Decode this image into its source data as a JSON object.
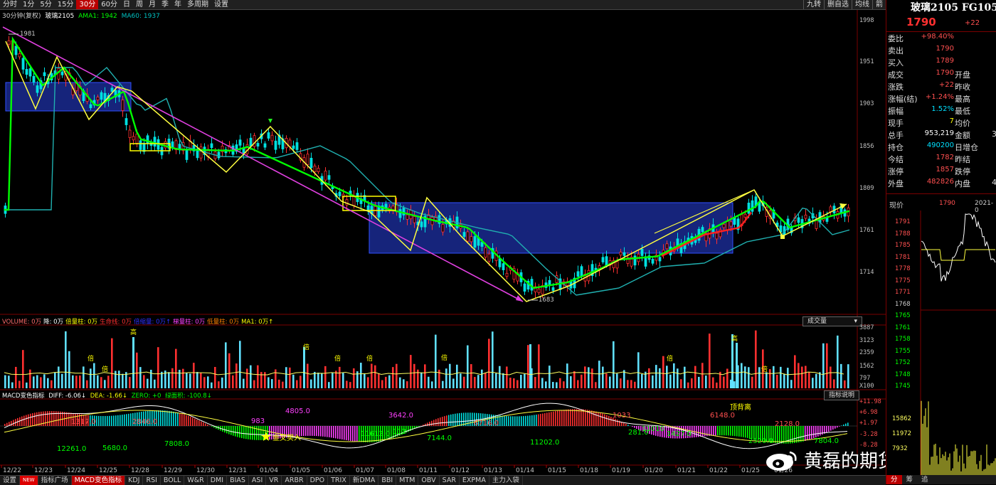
{
  "toolbar": {
    "period_tabs": [
      "分时",
      "1分",
      "5分",
      "15分",
      "30分",
      "60分",
      "日",
      "周",
      "月",
      "季",
      "年",
      "多周期",
      "设置"
    ],
    "active_tab": "30分",
    "right_buttons": [
      "九转",
      "删自选",
      "均线",
      "箭"
    ]
  },
  "main_info": {
    "period": "30分钟(复权)",
    "symbol": "玻璃2105",
    "ama": "AMA1: 1942",
    "ma60": "MA60: 1937"
  },
  "price_axis": [
    "1998",
    "1951",
    "1903",
    "1856",
    "1809",
    "1761",
    "1714"
  ],
  "price_labels": {
    "high": "1981",
    "low": "1683"
  },
  "volume_info": {
    "items": [
      {
        "text": "VOLUME: 0万",
        "color": "#ff6a6a"
      },
      {
        "text": "降: 0万",
        "color": "#ffffff"
      },
      {
        "text": "倍量柱: 0万",
        "color": "#ffff00"
      },
      {
        "text": "生命线: 0万",
        "color": "#ff3030"
      },
      {
        "text": "倍缩量: 0万↑",
        "color": "#3030ff"
      },
      {
        "text": "梯量柱: 0万",
        "color": "#ff40ff"
      },
      {
        "text": "低量柱: 0万",
        "color": "#ff8000"
      },
      {
        "text": "MA1: 0万↑",
        "color": "#ffff00"
      }
    ],
    "button": "成交量",
    "axis": [
      "3887",
      "3123",
      "2359",
      "1562",
      "797",
      "X100"
    ],
    "mark_bei": "倍",
    "mark_gao": "高"
  },
  "macd_info": {
    "name": "MACD变色指标",
    "diff": "DIFF: -6.06↓",
    "dea": "DEA: -1.66↓",
    "zero": "ZERO: +0",
    "area": "绿面积: -100.8↓",
    "button": "指标说明",
    "axis": [
      "+11.98",
      "+6.98",
      "+1.97",
      "-3.28",
      "-8.28"
    ],
    "values": [
      {
        "t": "1317.0",
        "c": "#ff5050"
      },
      {
        "t": "2846.0",
        "c": "#ff5050"
      },
      {
        "t": "12261.0",
        "c": "#00ff00"
      },
      {
        "t": "5680.0",
        "c": "#00ff00"
      },
      {
        "t": "7808.0",
        "c": "#00ff00"
      },
      {
        "t": "983",
        "c": "#ff40ff"
      },
      {
        "t": "4805.0",
        "c": "#ff40ff"
      },
      {
        "t": "3642.0",
        "c": "#ff40ff"
      },
      {
        "t": "11612.0",
        "c": "#00ff00"
      },
      {
        "t": "112",
        "c": "#00ff00"
      },
      {
        "t": "7144.0",
        "c": "#00ff00"
      },
      {
        "t": "6716.0",
        "c": "#ff5050"
      },
      {
        "t": "11202.0",
        "c": "#00ff00"
      },
      {
        "t": "1033",
        "c": "#ff5050"
      },
      {
        "t": "281.0",
        "c": "#00ff00"
      },
      {
        "t": "11010",
        "c": "#00ff00"
      },
      {
        "t": "1427.0",
        "c": "#00ff00"
      },
      {
        "t": "6148.0",
        "c": "#ff5050"
      },
      {
        "t": "2520.0",
        "c": "#00ff00"
      },
      {
        "t": "2128.0",
        "c": "#ff5050"
      },
      {
        "t": "7804.0",
        "c": "#00ff00"
      }
    ],
    "golden_cross": "金叉买入",
    "top_divergence": "顶背离"
  },
  "x_axis": [
    "12/22",
    "12/23",
    "12/24",
    "12/25",
    "12/28",
    "12/29",
    "12/30",
    "12/31",
    "01/04",
    "01/05",
    "01/06",
    "01/07",
    "01/08",
    "01/11",
    "01/12",
    "01/13",
    "01/14",
    "01/15",
    "01/18",
    "01/19",
    "01/20",
    "01/21",
    "01/22",
    "01/25",
    "01/26"
  ],
  "bottom_tabs": [
    "设置",
    "NEW",
    "指标广场",
    "MACD变色指标",
    "KDJ",
    "RSI",
    "BOLL",
    "W&R",
    "DMI",
    "BIAS",
    "ASI",
    "VR",
    "ARBR",
    "DPO",
    "TRIX",
    "新DMA",
    "BBI",
    "MTM",
    "OBV",
    "SAR",
    "EXPMA",
    "主力入袋"
  ],
  "bottom_active": "MACD变色指标",
  "watermark": "黄磊的期货人生",
  "quote": {
    "title": "玻璃2105 FG105",
    "last": "1790",
    "change": "+22",
    "rows": [
      {
        "l": "委比",
        "v": "+98.40%",
        "vc": "#ff5050",
        "l2": "",
        "v2": ""
      },
      {
        "l": "卖出",
        "v": "1790",
        "vc": "#ff5050",
        "l2": "",
        "v2": ""
      },
      {
        "l": "买入",
        "v": "1789",
        "vc": "#ff5050",
        "l2": "",
        "v2": ""
      },
      {
        "l": "成交",
        "v": "1790",
        "vc": "#ff5050",
        "l2": "开盘",
        "v2": ""
      },
      {
        "l": "涨跌",
        "v": "+22",
        "vc": "#ff5050",
        "l2": "昨收",
        "v2": ""
      },
      {
        "l": "涨幅(结)",
        "v": "+1.24%",
        "vc": "#ff5050",
        "l2": "最高",
        "v2": ""
      },
      {
        "l": "振幅",
        "v": "1.52%",
        "vc": "#00e0ff",
        "l2": "最低",
        "v2": ""
      },
      {
        "l": "现手",
        "v": "7",
        "vc": "#ffff00",
        "l2": "均价",
        "v2": ""
      },
      {
        "l": "总手",
        "v": "953,219",
        "vc": "#ffffff",
        "l2": "金额",
        "v2": "3"
      },
      {
        "l": "持仓",
        "v": "490200",
        "vc": "#00e0ff",
        "l2": "日增仓",
        "v2": ""
      },
      {
        "l": "今结",
        "v": "1782",
        "vc": "#ff5050",
        "l2": "昨结",
        "v2": ""
      },
      {
        "l": "涨停",
        "v": "1857",
        "vc": "#ff5050",
        "l2": "跌停",
        "v2": ""
      },
      {
        "l": "外盘",
        "v": "482826",
        "vc": "#ff5050",
        "l2": "内盘",
        "v2": "4"
      }
    ],
    "now_price_label": "现价",
    "now_price": "1790",
    "date": "2021-0",
    "mini_axis": [
      "1791",
      "1788",
      "1785",
      "1781",
      "1778",
      "1775",
      "1771",
      "1768",
      "1765",
      "1761",
      "1758",
      "1755",
      "1752",
      "1748",
      "1745"
    ],
    "mini_vol_axis": [
      "15862",
      "11972",
      "7932"
    ],
    "tabs": [
      "分",
      "筹",
      "追"
    ]
  }
}
